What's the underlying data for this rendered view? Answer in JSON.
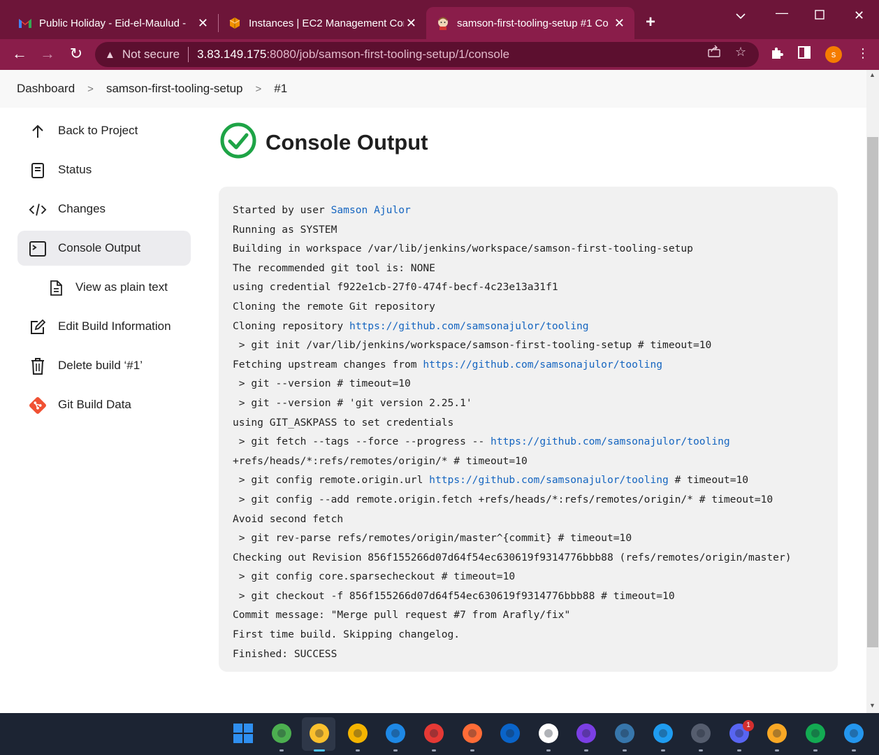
{
  "browser": {
    "tabs": [
      {
        "title": "Public Holiday - Eid-el-Maulud - ",
        "icon": "gmail-icon"
      },
      {
        "title": "Instances | EC2 Management Con",
        "icon": "aws-icon"
      },
      {
        "title": "samson-first-tooling-setup #1 Co",
        "icon": "jenkins-icon",
        "active": true
      }
    ],
    "security_label": "Not secure",
    "url_host": "3.83.149.175",
    "url_path": ":8080/job/samson-first-tooling-setup/1/console",
    "profile_initial": "s"
  },
  "breadcrumb": [
    "Dashboard",
    "samson-first-tooling-setup",
    "#1"
  ],
  "sidebar": {
    "items": [
      {
        "label": "Back to Project",
        "icon": "arrow-up-icon"
      },
      {
        "label": "Status",
        "icon": "document-icon"
      },
      {
        "label": "Changes",
        "icon": "code-icon"
      },
      {
        "label": "Console Output",
        "icon": "terminal-icon",
        "active": true
      },
      {
        "label": "View as plain text",
        "icon": "file-text-icon",
        "sub": true
      },
      {
        "label": "Edit Build Information",
        "icon": "edit-icon"
      },
      {
        "label": "Delete build ‘#1’",
        "icon": "trash-icon"
      },
      {
        "label": "Git Build Data",
        "icon": "git-icon"
      }
    ]
  },
  "main": {
    "title": "Console Output",
    "status": "success"
  },
  "console": {
    "lines": [
      [
        {
          "t": "Started by user "
        },
        {
          "t": "Samson Ajulor",
          "link": true
        }
      ],
      [
        {
          "t": "Running as SYSTEM"
        }
      ],
      [
        {
          "t": "Building in workspace /var/lib/jenkins/workspace/samson-first-tooling-setup"
        }
      ],
      [
        {
          "t": "The recommended git tool is: NONE"
        }
      ],
      [
        {
          "t": "using credential f922e1cb-27f0-474f-becf-4c23e13a31f1"
        }
      ],
      [
        {
          "t": "Cloning the remote Git repository"
        }
      ],
      [
        {
          "t": "Cloning repository "
        },
        {
          "t": "https://github.com/samsonajulor/tooling",
          "link": true
        }
      ],
      [
        {
          "t": " > git init /var/lib/jenkins/workspace/samson-first-tooling-setup # timeout=10"
        }
      ],
      [
        {
          "t": "Fetching upstream changes from "
        },
        {
          "t": "https://github.com/samsonajulor/tooling",
          "link": true
        }
      ],
      [
        {
          "t": " > git --version # timeout=10"
        }
      ],
      [
        {
          "t": " > git --version # 'git version 2.25.1'"
        }
      ],
      [
        {
          "t": "using GIT_ASKPASS to set credentials"
        }
      ],
      [
        {
          "t": " > git fetch --tags --force --progress -- "
        },
        {
          "t": "https://github.com/samsonajulor/tooling",
          "link": true
        }
      ],
      [
        {
          "t": "+refs/heads/*:refs/remotes/origin/* # timeout=10"
        }
      ],
      [
        {
          "t": " > git config remote.origin.url "
        },
        {
          "t": "https://github.com/samsonajulor/tooling",
          "link": true
        },
        {
          "t": " # timeout=10"
        }
      ],
      [
        {
          "t": " > git config --add remote.origin.fetch +refs/heads/*:refs/remotes/origin/* # timeout=10"
        }
      ],
      [
        {
          "t": "Avoid second fetch"
        }
      ],
      [
        {
          "t": " > git rev-parse refs/remotes/origin/master^{commit} # timeout=10"
        }
      ],
      [
        {
          "t": "Checking out Revision 856f155266d07d64f54ec630619f9314776bbb88 (refs/remotes/origin/master)"
        }
      ],
      [
        {
          "t": " > git config core.sparsecheckout # timeout=10"
        }
      ],
      [
        {
          "t": " > git checkout -f 856f155266d07d64f54ec630619f9314776bbb88 # timeout=10"
        }
      ],
      [
        {
          "t": "Commit message: \"Merge pull request #7 from Arafly/fix\""
        }
      ],
      [
        {
          "t": "First time build. Skipping changelog."
        }
      ],
      [
        {
          "t": "Finished: SUCCESS"
        }
      ]
    ]
  },
  "taskbar": {
    "apps": [
      {
        "name": "windows-start-icon",
        "color": "#2f8ff0"
      },
      {
        "name": "chrome-icon",
        "color": "#4caf50"
      },
      {
        "name": "chrome-profile-icon",
        "color": "#fbc02d",
        "active": true
      },
      {
        "name": "file-explorer-icon",
        "color": "#f4b400"
      },
      {
        "name": "edge-icon",
        "color": "#1e88e5"
      },
      {
        "name": "opera-icon",
        "color": "#e53935"
      },
      {
        "name": "postman-icon",
        "color": "#ff6c37"
      },
      {
        "name": "outlook-icon",
        "color": "#0a64c9"
      },
      {
        "name": "notion-icon",
        "color": "#ffffff"
      },
      {
        "name": "intellij-icon",
        "color": "#7b3fe4"
      },
      {
        "name": "python-icon",
        "color": "#3776ab"
      },
      {
        "name": "vscode-icon",
        "color": "#1f9cf0"
      },
      {
        "name": "terminal-icon",
        "color": "#555d6e"
      },
      {
        "name": "discord-icon",
        "color": "#5865f2",
        "badge": "1"
      },
      {
        "name": "paint-icon",
        "color": "#f9a825"
      },
      {
        "name": "mongodb-icon",
        "color": "#13aa52"
      },
      {
        "name": "docker-icon",
        "color": "#2496ed"
      }
    ]
  }
}
